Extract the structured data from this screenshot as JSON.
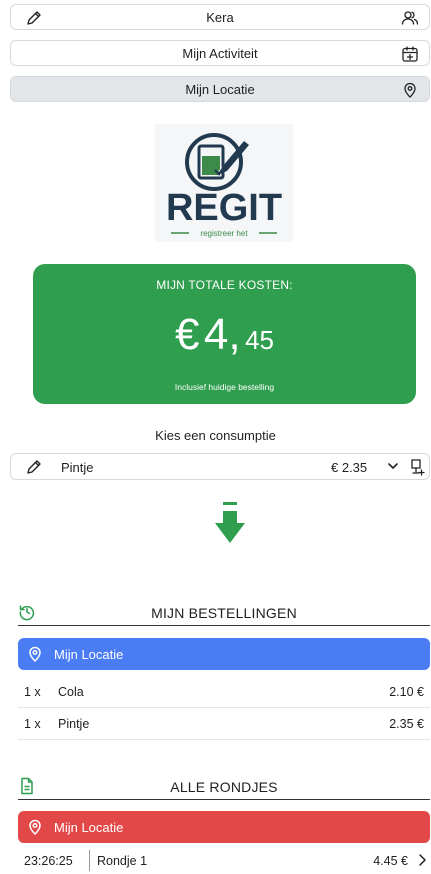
{
  "nav": {
    "kera": {
      "label": "Kera",
      "lead_icon": "pencil-icon",
      "trail_icon": "people-icon"
    },
    "activity": {
      "label": "Mijn Activiteit",
      "trail_icon": "calendar-add-icon"
    },
    "location": {
      "label": "Mijn Locatie",
      "trail_icon": "location-pin-icon"
    }
  },
  "logo": {
    "wordmark": "REGIT",
    "tagline": "registreer het"
  },
  "costs": {
    "title": "MIJN TOTALE KOSTEN:",
    "currency": "€",
    "amount_main": "4,",
    "amount_cents": "45",
    "note": "Inclusief huidige bestelling"
  },
  "consumption": {
    "prompt": "Kies een consumptie",
    "selected": "Pintje",
    "price": "€ 2.35"
  },
  "my_orders": {
    "title": "MIJN BESTELLINGEN",
    "location": "Mijn Locatie",
    "items": [
      {
        "qty": "1 x",
        "name": "Cola",
        "amount": "2.10 €"
      },
      {
        "qty": "1 x",
        "name": "Pintje",
        "amount": "2.35 €"
      }
    ]
  },
  "all_rounds": {
    "title": "ALLE RONDJES",
    "location": "Mijn Locatie",
    "rounds": [
      {
        "time": "23:26:25",
        "name": "Rondje 1",
        "total": "4.45 €"
      }
    ]
  },
  "colors": {
    "green": "#2f9e4f",
    "blue": "#4a7cf3",
    "red": "#e24848",
    "logo_navy": "#223a4f",
    "logo_green": "#3d8b4a"
  }
}
